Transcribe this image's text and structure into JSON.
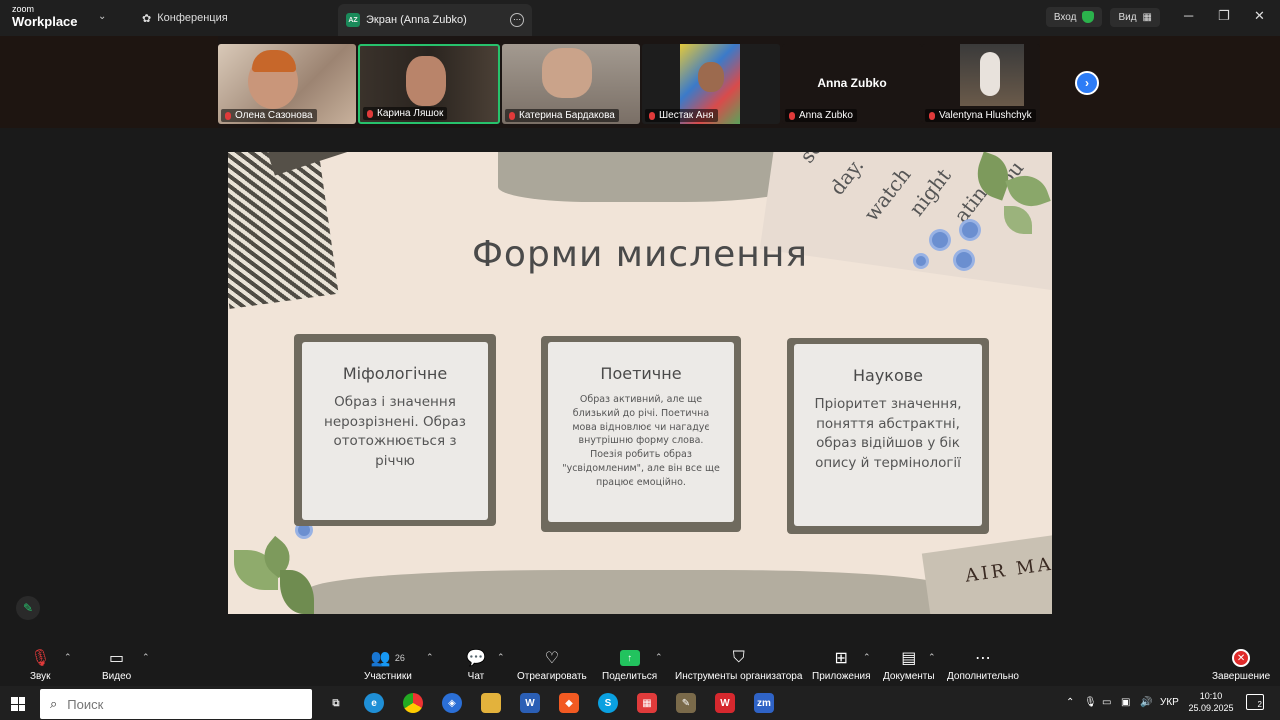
{
  "titlebar": {
    "logo_top": "zoom",
    "logo_bottom": "Workplace",
    "tab_conference": "Конференция",
    "tab_screen_badge": "AZ",
    "tab_screen": "Экран (Anna Zubko)",
    "signin": "Вход",
    "view": "Вид"
  },
  "participants": [
    {
      "name": "Олена Сазонова"
    },
    {
      "name": "Карина Ляшок"
    },
    {
      "name": "Катерина Бардакова"
    },
    {
      "name": "Шестак Аня"
    },
    {
      "name": "Anna Zubko"
    },
    {
      "name": "Valentyna Hlushchyk"
    }
  ],
  "anna_tile_label": "Anna Zubko",
  "slide": {
    "title": "Форми мислення",
    "cards": [
      {
        "heading": "Міфологічне",
        "body": "Образ і значення нерозрізнені. Образ ототожнюється з річчю"
      },
      {
        "heading": "Поетичне",
        "body": "Образ активний, але ще близький до річі. Поетична мова відновлює чи нагадує внутрішню форму слова. Поезія робить образ \"усвідомленим\", але він все ще працює емоційно."
      },
      {
        "heading": "Наукове",
        "body": "Пріоритет значення, поняття абстрактні, образ відійшов у бік опису й термінології"
      }
    ],
    "deco_news": [
      "so",
      "day.",
      "watch",
      "night",
      "ating.",
      "ou"
    ],
    "deco_stamp": "AIR MAIL"
  },
  "toolbar": {
    "audio": "Звук",
    "video": "Видео",
    "participants": "Участники",
    "participants_count": "26",
    "chat": "Чат",
    "react": "Отреагировать",
    "share": "Поделиться",
    "host_tools": "Инструменты организатора",
    "apps": "Приложения",
    "docs": "Документы",
    "more": "Дополнительно",
    "end": "Завершение"
  },
  "taskbar": {
    "search_placeholder": "Поиск",
    "lang": "УКР",
    "time": "10:10",
    "date": "25.09.2025",
    "notifications": "2"
  },
  "colors": {
    "active_speaker": "#27c26c",
    "share_green": "#22c35e",
    "end_red": "#e02b2b",
    "slide_bg": "#f1e4d8"
  }
}
